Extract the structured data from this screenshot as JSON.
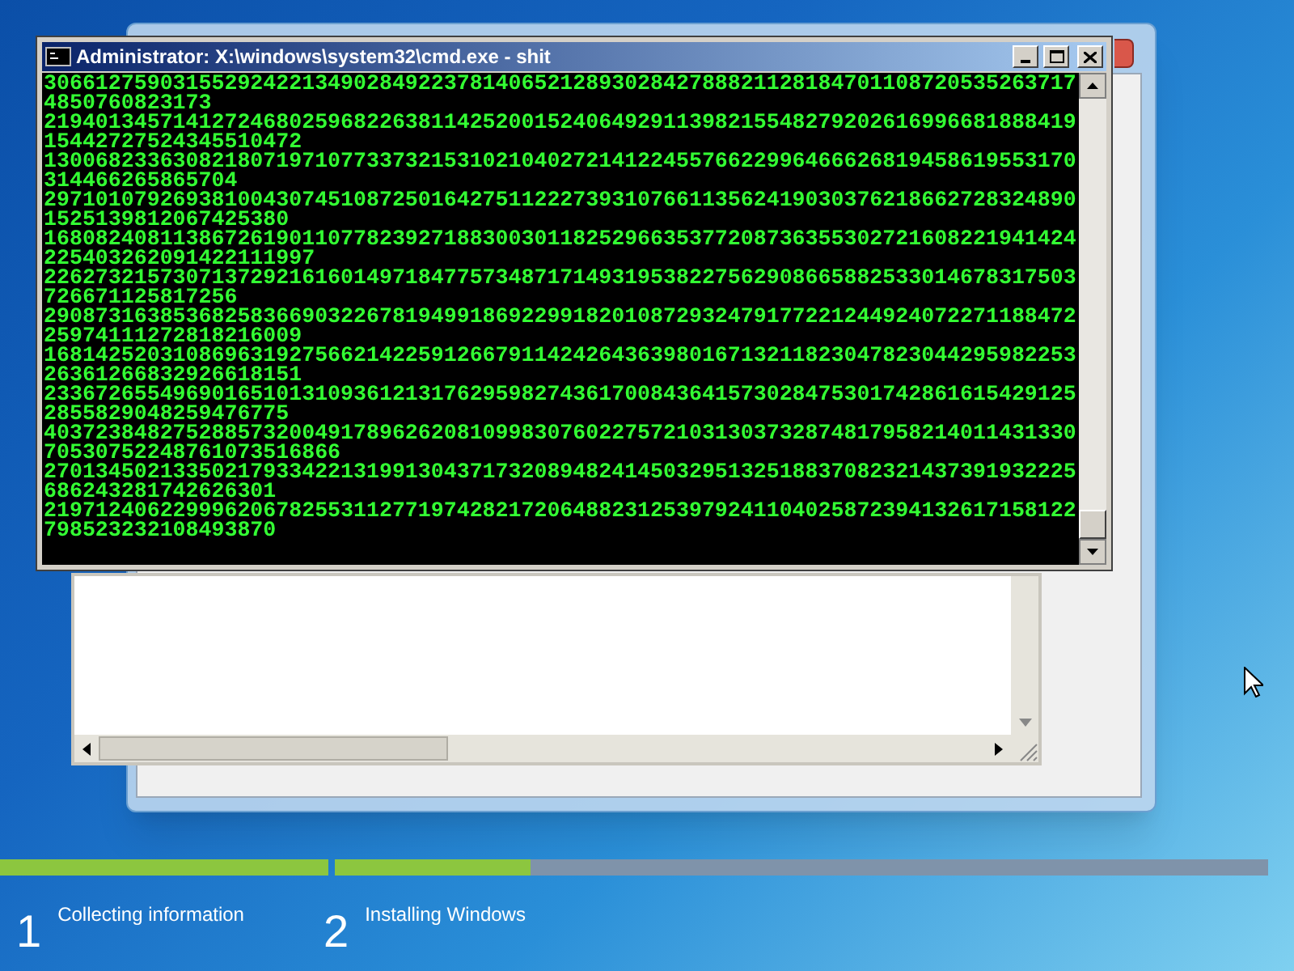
{
  "console_window": {
    "title": "Administrator: X:\\windows\\system32\\cmd.exe - shit",
    "lines": [
      "30661275903155292422134902849223781406521289302842788821128184701108720535263717",
      "4850760823173",
      "21940134571412724680259682263811425200152406492911398215548279202616996681888419",
      "15442727524345510472",
      "13006823363082180719710773373215310210402721412245576622996466626819458619553170",
      "314466265865704",
      "29710107926938100430745108725016427511222739310766113562419030376218662728324890",
      "1525139812067425380",
      "16808240811386726190110778239271883003011825296635377208736355302721608221941424",
      "225403262091422111997",
      "22627321573071372921616014971847757348717149319538227562908665882533014678317503",
      "726671125817256",
      "29087316385368258366903226781949918692299182010872932479177221244924072271188472",
      "25974111272818216009",
      "16814252031086963192756621422591266791142426436398016713211823047823044295982253",
      "26361266832926618151",
      "23367265549690165101310936121317629598274361700843641573028475301742861615429125",
      "2855829048259476775",
      "40372384827528857320049178962620810998307602275721031303732874817958214011431330",
      "70530752248761073516866",
      "27013450213350217933422131991304371732089482414503295132518837082321437391932225",
      "686243281742626301",
      "21971240622999620678255311277197428217206488231253979241104025872394132617158122",
      "798523232108493870"
    ]
  },
  "setup_steps": [
    {
      "number": "1",
      "label": "Collecting information",
      "level": 1
    },
    {
      "number": "2",
      "label": "Installing Windows",
      "level": 0.21
    }
  ]
}
